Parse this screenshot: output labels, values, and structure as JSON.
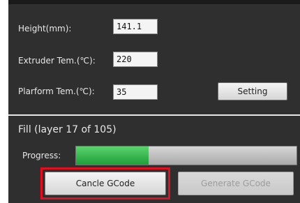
{
  "settings": {
    "height_label": "Height(mm):",
    "height_value": "141.1",
    "extruder_label": "Extruder Tem.(℃):",
    "extruder_value": "220",
    "platform_label": "Plarform Tem.(℃):",
    "platform_value": "35",
    "setting_button": "Setting"
  },
  "status": {
    "title": "Fill (layer 17 of 105)",
    "progress_label": "Progress:",
    "progress_fraction": 0.33
  },
  "actions": {
    "cancel_label": "Cancle GCode",
    "generate_label": "Generate GCode"
  },
  "colors": {
    "highlight": "#e01020",
    "progress_fill": "#1f9e3a"
  }
}
